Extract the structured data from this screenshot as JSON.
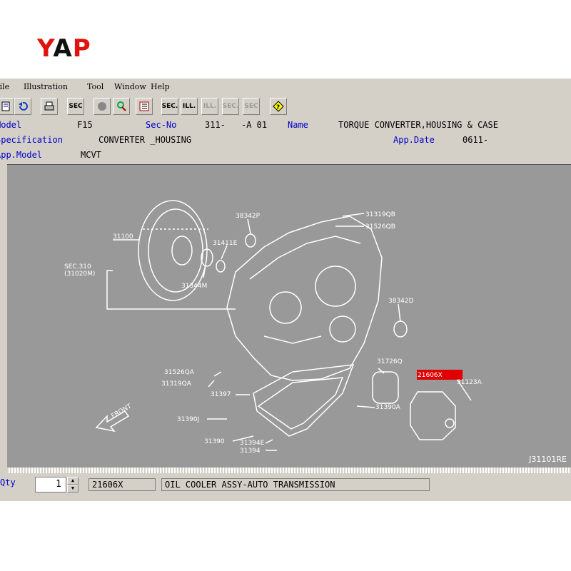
{
  "logo": {
    "y": "Y",
    "a": "A",
    "p": "P"
  },
  "menu": [
    "File",
    "Illustration",
    "Tool",
    "Window",
    "Help"
  ],
  "toolbar": {
    "sec": "SEC",
    "sec2": "SEC.",
    "ill": "ILL.",
    "ill_dis": "ILL.",
    "sec_dis": "SEC.",
    "sec_q": "SEC"
  },
  "header": {
    "model_label": "Model",
    "model_value": "F15",
    "secno_label": "Sec-No",
    "secno_value": "311-",
    "secno_suffix": "-A 01",
    "name_label": "Name",
    "name_value": "TORQUE CONVERTER,HOUSING & CASE",
    "spec_label": "Specification",
    "spec_value": "CONVERTER _HOUSING",
    "appdate_label": "App.Date",
    "appdate_value": "0611-",
    "appmodel_label": "App.Model",
    "appmodel_value": "MCVT"
  },
  "diagram": {
    "labels": {
      "p31100": "31100",
      "sec310": "SEC.310",
      "sec310b": "(31020M)",
      "p31344M": "31344M",
      "p31411E": "31411E",
      "p38342P": "38342P",
      "p31319QB": "31319QB",
      "p31526QB": "31526QB",
      "p38342D": "38342D",
      "p31726Q": "31726Q",
      "p21606X": "21606X",
      "p31123A": "31123A",
      "p31390A": "31390A",
      "p31526QA": "31526QA",
      "p31319QA": "31319QA",
      "p31397": "31397",
      "p31390J": "31390J",
      "p31390": "31390",
      "p31394E": "31394E",
      "p31394": "31394",
      "front": "FRONT"
    },
    "highlight_color": "#e00000",
    "ref": "J31101RE"
  },
  "footer": {
    "qty_label": "Qty",
    "qty_value": "1",
    "part_no": "21606X",
    "part_name": "OIL COOLER ASSY-AUTO TRANSMISSION"
  }
}
